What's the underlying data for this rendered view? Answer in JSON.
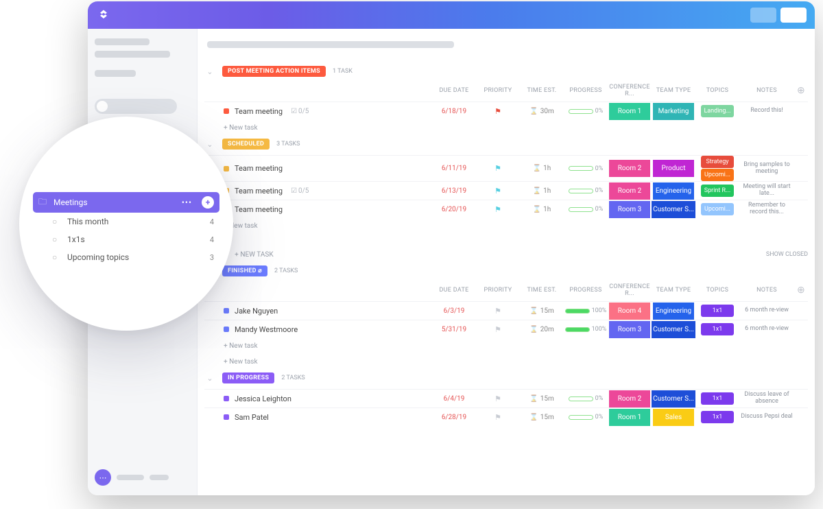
{
  "columns": {
    "due": "DUE DATE",
    "priority": "PRIORITY",
    "time": "TIME EST.",
    "progress": "PROGRESS",
    "conf": "CONFERENCE R...",
    "team": "TEAM TYPE",
    "topics": "TOPICS",
    "notes": "NOTES"
  },
  "new_task_label": "+ New task",
  "section_new_task": "+ NEW TASK",
  "show_closed": "SHOW CLOSED",
  "task_count_suffix_singular": "TASK",
  "task_count_suffix_plural": "TASKS",
  "groups": [
    {
      "status": "POST MEETING ACTION ITEMS",
      "status_color": "#fd5a3e",
      "task_count_label": "1 TASK",
      "show_header": true,
      "tasks": [
        {
          "dot": "#fd5a3e",
          "name": "Team meeting",
          "sub": "0/5",
          "due": "6/18/19",
          "flag": "#e74c3c",
          "time": "30m",
          "progress": 0,
          "conf": {
            "label": "Room 1",
            "color": "#2ecc9b"
          },
          "team": {
            "label": "Marketing",
            "color": "#2fb5b5"
          },
          "topic": {
            "label": "Landing...",
            "color": "#7ed6a0"
          },
          "note": "Record this!"
        }
      ]
    },
    {
      "status": "SCHEDULED",
      "status_color": "#f5b942",
      "task_count_label": "3 TASKS",
      "show_header": false,
      "tasks": [
        {
          "dot": "#f5b942",
          "name": "Team meeting",
          "sub": "",
          "due": "6/11/19",
          "flag": "#56cfe1",
          "time": "1h",
          "progress": 0,
          "conf": {
            "label": "Room 2",
            "color": "#ec4899"
          },
          "team": {
            "label": "Product",
            "color": "#c026d3"
          },
          "topic": {
            "label": "Strategy",
            "color": "#e74c3c"
          },
          "topic2": {
            "label": "Upcomi...",
            "color": "#f97316"
          },
          "note": "Bring samples to meeting"
        },
        {
          "dot": "#f5b942",
          "name": "Team meeting",
          "sub": "0/5",
          "due": "6/13/19",
          "flag": "#56cfe1",
          "time": "1h",
          "progress": 0,
          "conf": {
            "label": "Room 2",
            "color": "#ec4899"
          },
          "team": {
            "label": "Engineering",
            "color": "#2563eb"
          },
          "topic": {
            "label": "Sprint R...",
            "color": "#22c55e"
          },
          "note": "Meeting will start late..."
        },
        {
          "dot": "#f5b942",
          "name": "Team meeting",
          "sub": "",
          "due": "6/20/19",
          "flag": "#56cfe1",
          "time": "1h",
          "progress": 0,
          "conf": {
            "label": "Room 3",
            "color": "#6366f1"
          },
          "team": {
            "label": "Customer S...",
            "color": "#1d4ed8"
          },
          "topic": {
            "label": "Upcomi...",
            "color": "#93c5fd"
          },
          "note": "Remember to record this..."
        }
      ]
    }
  ],
  "groups2": [
    {
      "status": "FINISHED",
      "status_color": "#6b7cff",
      "task_count_label": "2 TASKS",
      "show_header": true,
      "finished_icon": true,
      "tasks": [
        {
          "dot": "#6b7cff",
          "name": "Jake Nguyen",
          "due": "6/3/19",
          "flag": "#c8ccd3",
          "time": "15m",
          "progress": 100,
          "conf": {
            "label": "Room 4",
            "color": "#fb7185"
          },
          "team": {
            "label": "Engineering",
            "color": "#2563eb"
          },
          "topic": {
            "label": "1x1",
            "color": "#7c3aed"
          },
          "note": "6 month re-view"
        },
        {
          "dot": "#6b7cff",
          "name": "Mandy Westmoore",
          "due": "5/31/19",
          "flag": "#c8ccd3",
          "time": "20m",
          "progress": 100,
          "conf": {
            "label": "Room 3",
            "color": "#6366f1"
          },
          "team": {
            "label": "Customer S...",
            "color": "#1d4ed8"
          },
          "topic": {
            "label": "1x1",
            "color": "#7c3aed"
          },
          "note": "6 month re-view"
        }
      ]
    },
    {
      "status": "IN PROGRESS",
      "status_color": "#8b5cf6",
      "task_count_label": "2 TASKS",
      "show_header": false,
      "tasks": [
        {
          "dot": "#8b5cf6",
          "name": "Jessica Leighton",
          "due": "6/4/19",
          "flag": "#c8ccd3",
          "time": "15m",
          "progress": 0,
          "conf": {
            "label": "Room 2",
            "color": "#ec4899"
          },
          "team": {
            "label": "Customer S...",
            "color": "#1d4ed8"
          },
          "topic": {
            "label": "1x1",
            "color": "#7c3aed"
          },
          "note": "Discuss leave of absence"
        },
        {
          "dot": "#8b5cf6",
          "name": "Sam Patel",
          "due": "6/28/19",
          "flag": "#c8ccd3",
          "time": "15m",
          "progress": 0,
          "conf": {
            "label": "Room 1",
            "color": "#2ecc9b"
          },
          "team": {
            "label": "Sales",
            "color": "#facc15"
          },
          "topic": {
            "label": "1x1",
            "color": "#7c3aed"
          },
          "note": "Discuss Pepsi deal"
        }
      ]
    }
  ],
  "zoom": {
    "active": {
      "icon": "folder",
      "label": "Meetings"
    },
    "items": [
      {
        "label": "This month",
        "count": "4"
      },
      {
        "label": "1x1s",
        "count": "4"
      },
      {
        "label": "Upcoming topics",
        "count": "3"
      }
    ]
  }
}
